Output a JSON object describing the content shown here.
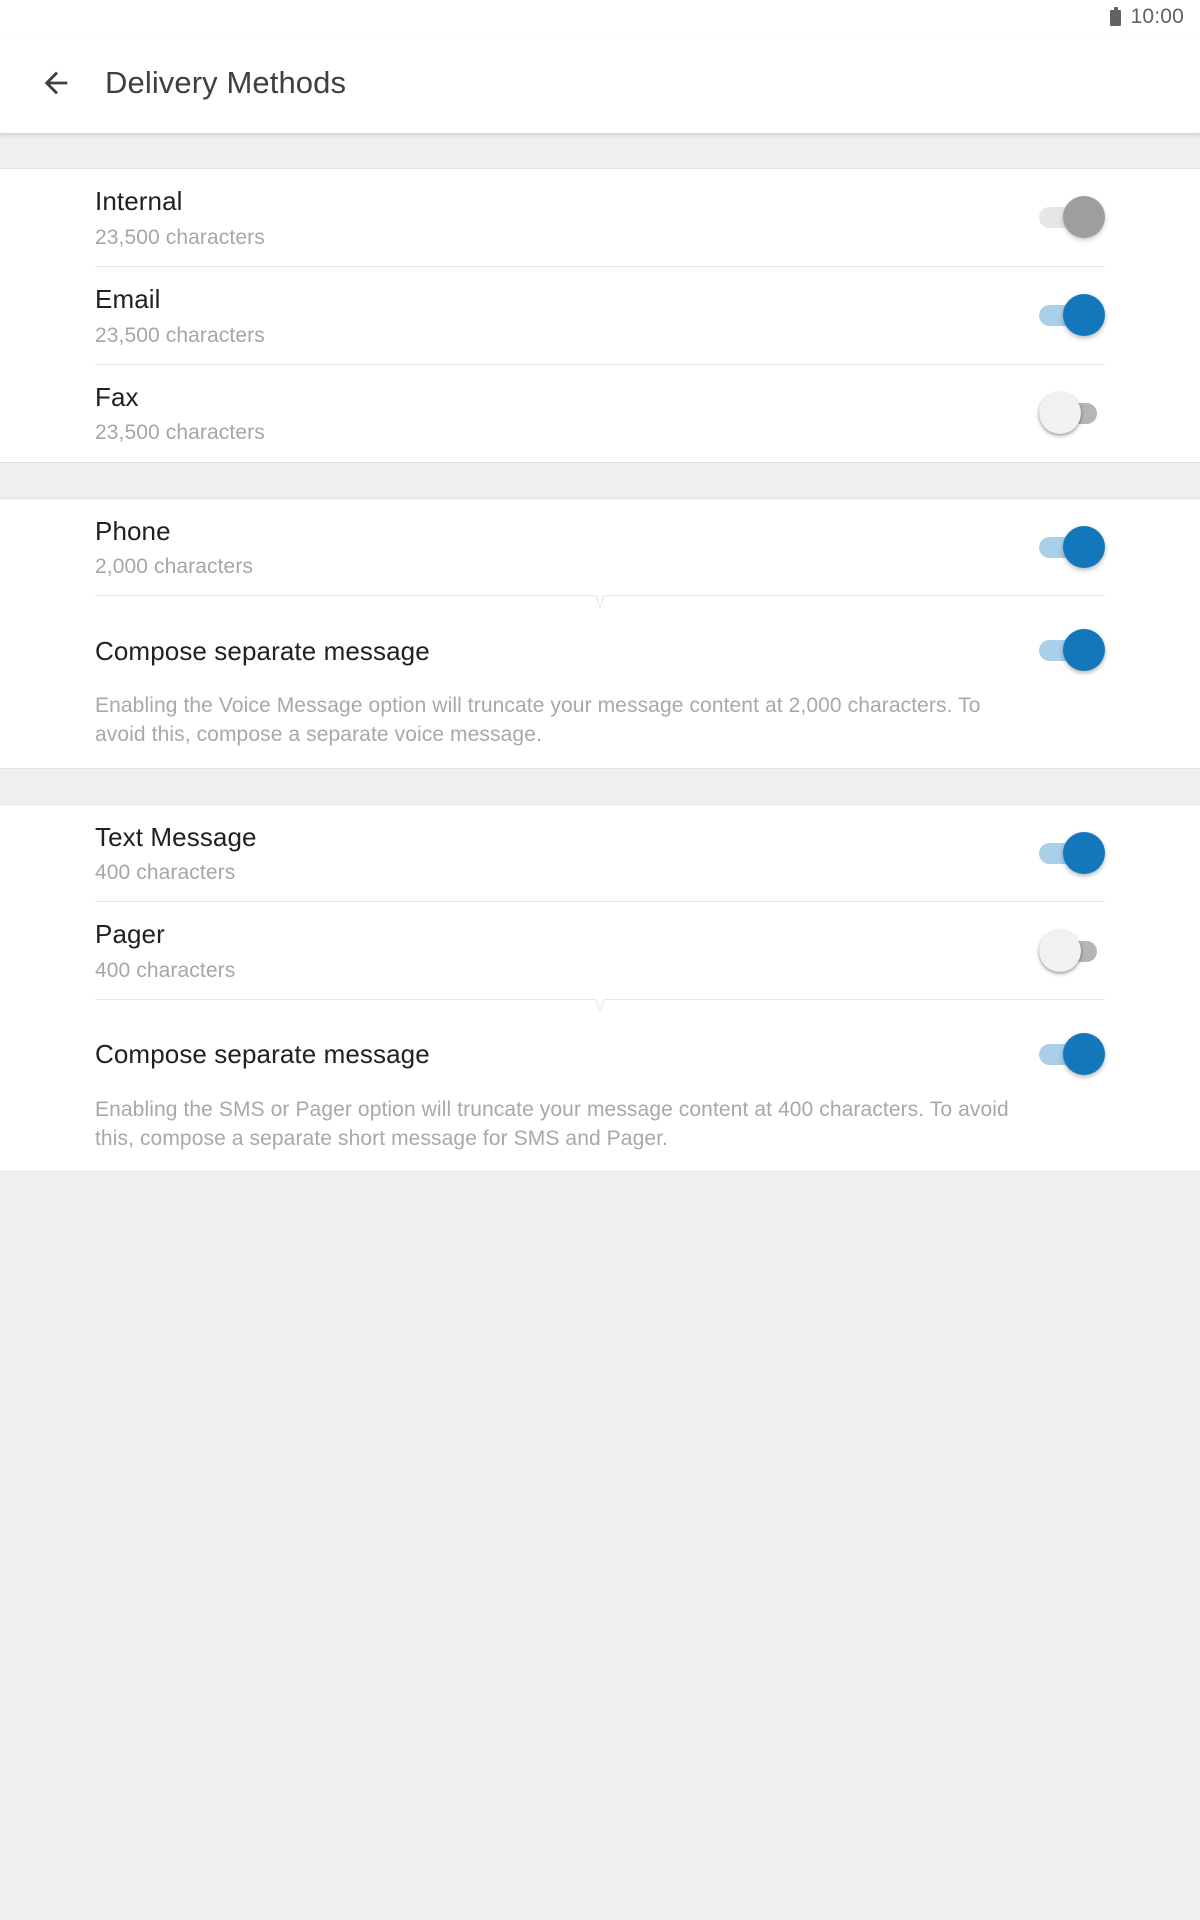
{
  "status_bar": {
    "battery_icon": "battery-full-icon",
    "time": "10:00"
  },
  "app_bar": {
    "back_icon": "back-arrow-icon",
    "title": "Delivery Methods"
  },
  "colors": {
    "accent_blue": "#1277bb",
    "track_blue": "#a9cfe9",
    "disabled_grey": "#9e9e9e",
    "track_grey": "#b5b5b5",
    "page_background": "#efefef",
    "card_background": "#ffffff",
    "title_text": "#202124",
    "secondary_text": "#a6a6a6"
  },
  "sections": [
    {
      "id": "long-form",
      "rows": [
        {
          "name": "internal",
          "title": "Internal",
          "subtitle": "23,500 characters",
          "toggle": {
            "state": "on-disabled",
            "label": "Internal toggle"
          }
        },
        {
          "name": "email",
          "title": "Email",
          "subtitle": "23,500 characters",
          "toggle": {
            "state": "on",
            "label": "Email toggle"
          }
        },
        {
          "name": "fax",
          "title": "Fax",
          "subtitle": "23,500 characters",
          "toggle": {
            "state": "off",
            "label": "Fax toggle"
          }
        }
      ]
    },
    {
      "id": "voice",
      "rows": [
        {
          "name": "phone",
          "title": "Phone",
          "subtitle": "2,000 characters",
          "toggle": {
            "state": "on",
            "label": "Phone toggle"
          }
        },
        {
          "name": "voice-compose-separate-message",
          "title": "Compose separate message",
          "description": "Enabling the Voice Message option will truncate your message content at 2,000 characters. To avoid this, compose a separate voice message.",
          "toggle": {
            "state": "on",
            "label": "Compose separate voice message toggle"
          }
        }
      ]
    },
    {
      "id": "short-form",
      "rows": [
        {
          "name": "text-message",
          "title": "Text Message",
          "subtitle": "400 characters",
          "toggle": {
            "state": "on",
            "label": "Text Message toggle"
          }
        },
        {
          "name": "pager",
          "title": "Pager",
          "subtitle": "400 characters",
          "toggle": {
            "state": "off",
            "label": "Pager toggle"
          }
        },
        {
          "name": "sms-compose-separate-message",
          "title": "Compose separate message",
          "description": "Enabling the SMS or Pager option will truncate your message content at 400 characters. To avoid this, compose a separate short message for SMS and Pager.",
          "toggle": {
            "state": "on",
            "label": "Compose separate short message toggle"
          }
        }
      ]
    }
  ]
}
